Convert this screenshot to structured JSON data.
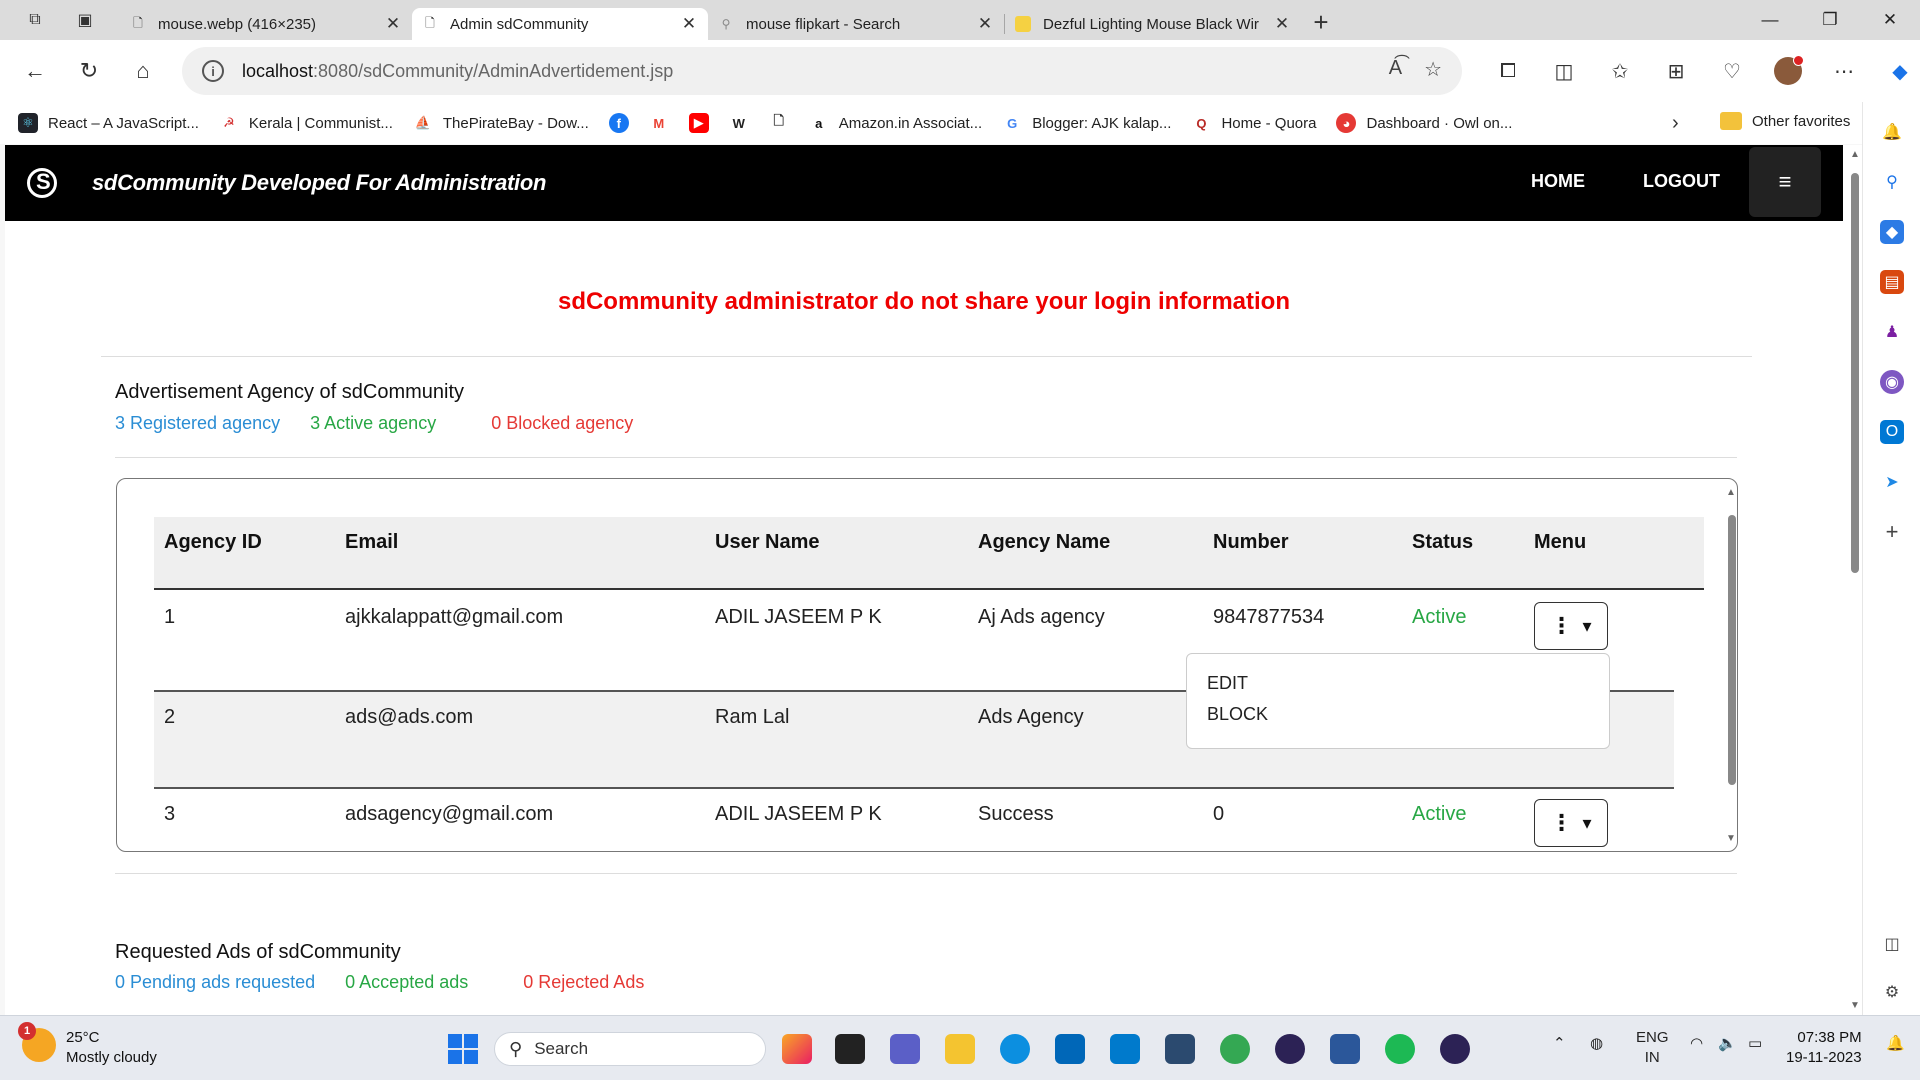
{
  "browser": {
    "tabs": [
      {
        "title": "mouse.webp (416×235)"
      },
      {
        "title": "Admin sdCommunity"
      },
      {
        "title": "mouse flipkart - Search"
      },
      {
        "title": "Dezful Lighting Mouse Black Wir"
      }
    ],
    "url_host": "localhost",
    "url_rest": ":8080/sdCommunity/AdminAdvertidement.jsp",
    "bookmarks": [
      {
        "label": "React – A JavaScript..."
      },
      {
        "label": "Kerala | Communist..."
      },
      {
        "label": "ThePirateBay - Dow..."
      },
      {
        "label": "Amazon.in Associat..."
      },
      {
        "label": "Blogger: AJK kalap..."
      },
      {
        "label": "Home - Quora"
      },
      {
        "label": "Dashboard · Owl on..."
      }
    ],
    "other_favorites": "Other favorites"
  },
  "site": {
    "brand": "sdCommunity Developed For Administration",
    "nav": {
      "home": "HOME",
      "logout": "LOGOUT"
    },
    "warning": "sdCommunity administrator do not share your login information",
    "agency_section": {
      "title": "Advertisement Agency of sdCommunity",
      "registered": "3 Registered agency",
      "active": "3 Active agency",
      "blocked": "0 Blocked agency"
    },
    "table": {
      "headers": [
        "Agency ID",
        "Email",
        "User Name",
        "Agency Name",
        "Number",
        "Status",
        "Menu"
      ],
      "rows": [
        {
          "id": "1",
          "email": "ajkkalappatt@gmail.com",
          "user": "ADIL JASEEM P K",
          "agency": "Aj Ads agency",
          "number": "9847877534",
          "status": "Active"
        },
        {
          "id": "2",
          "email": "ads@ads.com",
          "user": "Ram Lal",
          "agency": "Ads Agency",
          "number": "",
          "status": ""
        },
        {
          "id": "3",
          "email": "adsagency@gmail.com",
          "user": "ADIL JASEEM P K",
          "agency": "Success",
          "number": "0",
          "status": "Active"
        }
      ]
    },
    "dropdown": {
      "edit": "EDIT",
      "block": "BLOCK"
    },
    "ads_section": {
      "title": "Requested Ads of sdCommunity",
      "pending": "0 Pending ads requested",
      "accepted": "0 Accepted ads",
      "rejected": "0 Rejected Ads"
    }
  },
  "taskbar": {
    "weather_temp": "25°C",
    "weather_desc": "Mostly cloudy",
    "weather_badge": "1",
    "search": "Search",
    "lang1": "ENG",
    "lang2": "IN",
    "time": "07:38 PM",
    "date": "19-11-2023"
  },
  "colors": {
    "accent_blue": "#2a8dd4",
    "active_green": "#28a745",
    "alert_red": "#e53935",
    "warning_red": "#e00000",
    "navbar": "#000000"
  }
}
